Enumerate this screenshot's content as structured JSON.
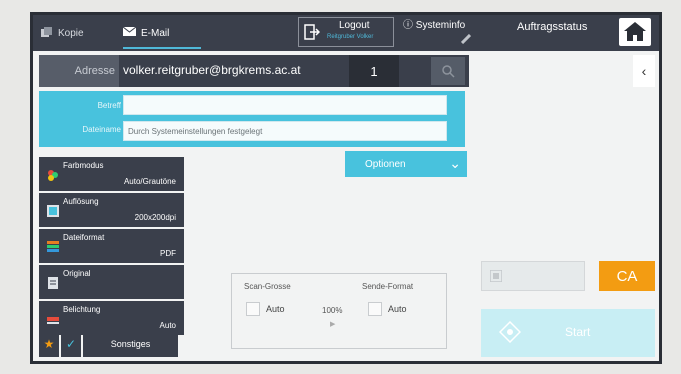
{
  "topbar": {
    "tabs": [
      {
        "label": "Kopie",
        "icon": "copy-icon",
        "active": false
      },
      {
        "label": "E-Mail",
        "icon": "envelope-icon",
        "active": true
      }
    ],
    "logout": {
      "label": "Logout",
      "user": "Reitgruber Volker"
    },
    "system_info": "Systeminfo",
    "status_label": "Auftragsstatus"
  },
  "address": {
    "button_label": "Adresse",
    "value": "volker.reitgruber@brgkrems.ac.at",
    "count": "1"
  },
  "fields": {
    "subject_label": "Betreff",
    "subject_value": "",
    "filename_label": "Dateiname",
    "filename_value": "Durch Systemeinstellungen festgelegt"
  },
  "options_label": "Optionen",
  "settings": [
    {
      "name": "Farbmodus",
      "value": "Auto/Grautöne",
      "icon": "color-mode-icon"
    },
    {
      "name": "Auflösung",
      "value": "200x200dpi",
      "icon": "resolution-icon"
    },
    {
      "name": "Dateiformat",
      "value": "PDF",
      "icon": "file-format-icon"
    },
    {
      "name": "Original",
      "value": "",
      "icon": "original-icon"
    },
    {
      "name": "Belichtung",
      "value": "Auto",
      "icon": "exposure-icon"
    }
  ],
  "bottom": {
    "other_label": "Sonstiges"
  },
  "scan": {
    "size_label": "Scan-Grosse",
    "size_value": "Auto",
    "zoom": "100%",
    "send_format_label": "Sende-Format",
    "send_format_value": "Auto"
  },
  "actions": {
    "ca_label": "CA",
    "start_label": "Start"
  },
  "colors": {
    "accent": "#48c2dd",
    "dark": "#3a3f4b",
    "orange": "#f39c12"
  }
}
